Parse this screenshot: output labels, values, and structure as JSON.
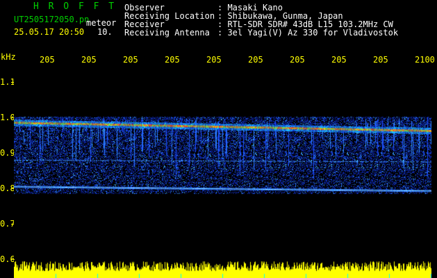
{
  "header": {
    "logo": "H R O F F T",
    "filename": "UT2505172050.pn",
    "meteor_label": "meteor",
    "datetime": "25.05.17 20:50",
    "count": "10.",
    "info_labels": [
      "Observer",
      "Receiving Location",
      "Receiver",
      "Receiving Antenna"
    ],
    "info_values": [
      ": Masaki Kano",
      ": Shibukawa, Gunma, Japan",
      ": RTL-SDR SDR# 43dB L15 103.2MHz CW",
      ": 3el Yagi(V) Az 330 for Vladivostok"
    ]
  },
  "colors": {
    "logo": "#00d000",
    "text": "#ffffff",
    "axis": "#ffff00",
    "background": "#000000",
    "histogram": "#ffff00",
    "grid": "#00ffff"
  },
  "chart_data": {
    "type": "heatmap",
    "y_unit_label": "kHz",
    "x_tick_labels": [
      "205",
      "205",
      "205",
      "205",
      "205",
      "205",
      "205",
      "205",
      "205",
      "2100"
    ],
    "y_tick_labels": [
      "1.1",
      "1.0",
      "0.9",
      "0.8",
      "0.7",
      "0.6"
    ],
    "y_ticks": [
      1.1,
      1.0,
      0.9,
      0.8,
      0.7,
      0.6
    ],
    "ylim": [
      0.6,
      1.15
    ],
    "grid": false,
    "bands": [
      {
        "freq_start": 0.985,
        "freq_end": 0.962,
        "intensity": "strong"
      },
      {
        "freq_start": 0.88,
        "freq_end": 0.875,
        "intensity": "weak"
      },
      {
        "freq_start": 0.805,
        "freq_end": 0.793,
        "intensity": "medium"
      }
    ]
  }
}
